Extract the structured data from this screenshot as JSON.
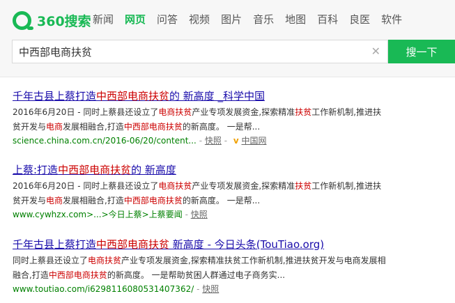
{
  "logo": {
    "text": "360搜索"
  },
  "nav": {
    "items": [
      {
        "label": "新闻",
        "active": false
      },
      {
        "label": "网页",
        "active": true
      },
      {
        "label": "问答",
        "active": false
      },
      {
        "label": "视频",
        "active": false
      },
      {
        "label": "图片",
        "active": false
      },
      {
        "label": "音乐",
        "active": false
      },
      {
        "label": "地图",
        "active": false
      },
      {
        "label": "百科",
        "active": false
      },
      {
        "label": "良医",
        "active": false
      },
      {
        "label": "软件",
        "active": false
      }
    ]
  },
  "search": {
    "query": "中西部电商扶贫",
    "button_label": "搜一下",
    "clear_icon": "close-icon"
  },
  "results": [
    {
      "title_parts": [
        {
          "text": "千年古县上蔡打造",
          "hl": false
        },
        {
          "text": "中西部电商扶贫",
          "hl": true
        },
        {
          "text": "的 新高度 _科学中国",
          "hl": false
        }
      ],
      "snippet_parts": [
        {
          "text": "2016年6月20日 - 同时上蔡县还设立了",
          "hl": false
        },
        {
          "text": "电商扶贫",
          "hl": true
        },
        {
          "text": "产业专项发展资金,探索精准",
          "hl": false
        },
        {
          "text": "扶贫",
          "hl": true
        },
        {
          "text": "工作新机制,推进扶贫开发与",
          "hl": false
        },
        {
          "text": "电商",
          "hl": true
        },
        {
          "text": "发展相融合,打造",
          "hl": false
        },
        {
          "text": "中西部电商扶贫",
          "hl": true
        },
        {
          "text": "的新高度。 一是帮...",
          "hl": false
        }
      ],
      "url": "science.china.com.cn/2016-06/20/content...",
      "snapshot_label": "快照",
      "source": "中国网"
    },
    {
      "title_parts": [
        {
          "text": "上蔡:打造",
          "hl": false
        },
        {
          "text": "中西部电商扶贫",
          "hl": true
        },
        {
          "text": "的 新高度",
          "hl": false
        }
      ],
      "snippet_parts": [
        {
          "text": "2016年6月20日 - 同时上蔡县还设立了",
          "hl": false
        },
        {
          "text": "电商扶贫",
          "hl": true
        },
        {
          "text": "产业专项发展资金,探索精准",
          "hl": false
        },
        {
          "text": "扶贫",
          "hl": true
        },
        {
          "text": "工作新机制,推进扶贫开发与",
          "hl": false
        },
        {
          "text": "电商",
          "hl": true
        },
        {
          "text": "发展相融合,打造",
          "hl": false
        },
        {
          "text": "中西部电商扶贫",
          "hl": true
        },
        {
          "text": "的新高度。 一是帮...",
          "hl": false
        }
      ],
      "url": "www.cywhzx.com>...>今日上蔡>上蔡要闻",
      "snapshot_label": "快照",
      "source": ""
    },
    {
      "title_parts": [
        {
          "text": "千年古县上蔡打造",
          "hl": false
        },
        {
          "text": "中西部电商扶贫",
          "hl": true
        },
        {
          "text": " 新高度 - 今日头条(TouTiao.org)",
          "hl": false
        }
      ],
      "snippet_parts": [
        {
          "text": "同时上蔡县还设立了",
          "hl": false
        },
        {
          "text": "电商扶贫",
          "hl": true
        },
        {
          "text": "产业专项发展资金,探索精准扶贫工作新机制,推进扶贫开发与电商发展相融合,打造",
          "hl": false
        },
        {
          "text": "中西部电商扶贫",
          "hl": true
        },
        {
          "text": "的新高度。 一是帮助贫困人群通过电子商务实...",
          "hl": false
        }
      ],
      "url": "www.toutiao.com/i6298116080531407362/",
      "snapshot_label": "快照",
      "source": ""
    }
  ],
  "colors": {
    "brand": "#19b955",
    "link": "#1a0dab",
    "highlight": "#cc0000",
    "url": "#008000"
  }
}
